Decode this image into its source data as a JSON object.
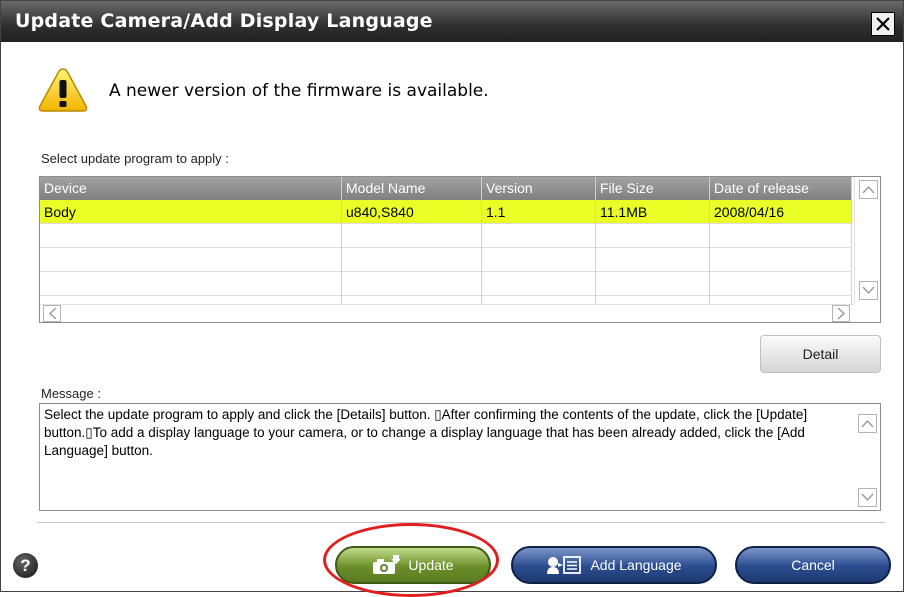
{
  "window": {
    "title": "Update Camera/Add Display Language"
  },
  "notice": {
    "icon": "warning-icon",
    "text": "A newer version of the firmware is available."
  },
  "select_label": "Select update program to apply :",
  "table": {
    "columns": [
      "Device",
      "Model Name",
      "Version",
      "File Size",
      "Date of release"
    ],
    "rows": [
      {
        "device": "Body",
        "model": "u840,S840",
        "version": "1.1",
        "size": "11.1MB",
        "date": "2008/04/16",
        "selected": true
      }
    ],
    "selected_color": "#e9ff25"
  },
  "detail_button": "Detail",
  "message": {
    "label": "Message :",
    "text": "Select the update program to apply and click the [Details] button. ▯After confirming the contents of the update, click the [Update] button.▯To add a display language to your camera, or to change a display language that has been already added, click the [Add Language] button."
  },
  "buttons": {
    "update": "Update",
    "add_language": "Add Language",
    "cancel": "Cancel",
    "help": "?"
  },
  "colors": {
    "titlebar": "#2f2f2f",
    "update_green": "#6b8f2a",
    "blue_button": "#2a4c8f",
    "highlight_red": "#e21f1f"
  }
}
